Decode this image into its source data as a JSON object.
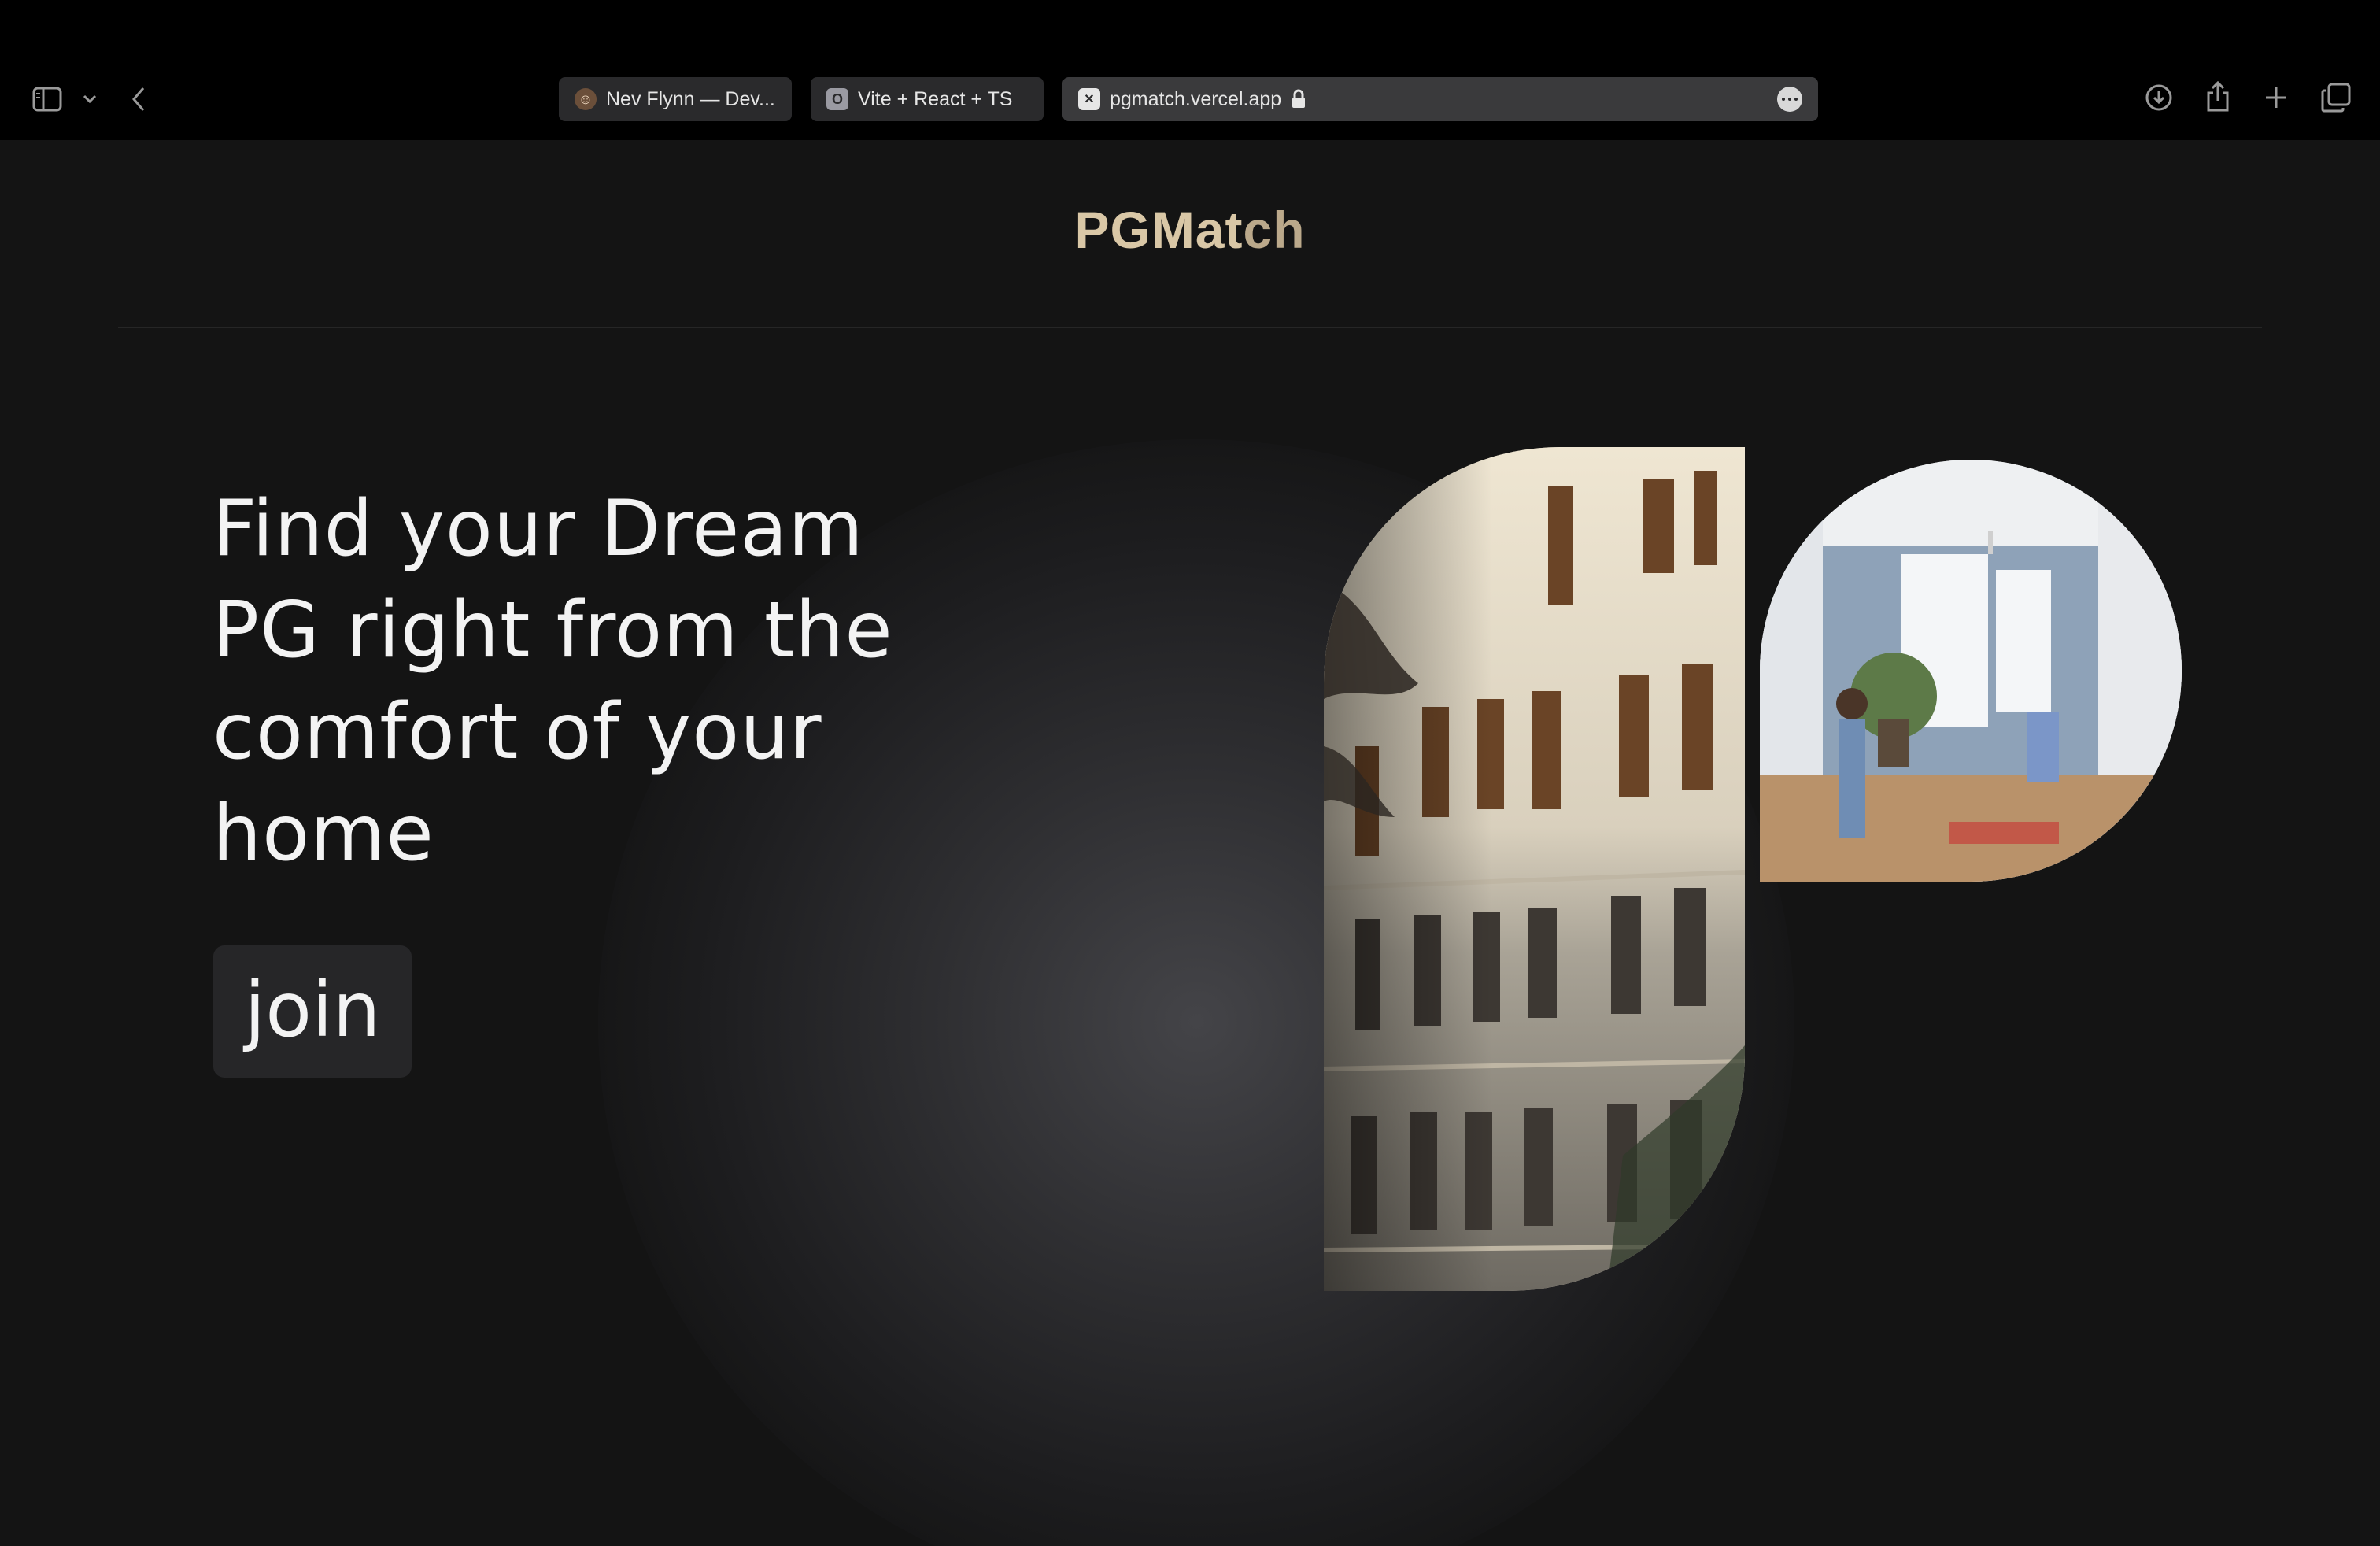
{
  "browser": {
    "tabs": [
      {
        "label": "Nev Flynn — Dev...",
        "favicon": "avatar-icon"
      },
      {
        "label": "Vite + React + TS",
        "favicon": "O"
      },
      {
        "label": "pgmatch.vercel.app",
        "favicon": "x-favicon",
        "active": true
      }
    ],
    "icons": [
      "sidebar-icon",
      "chevron-down-icon",
      "back-icon",
      "lock-icon",
      "more-icon",
      "download-icon",
      "share-icon",
      "new-tab-icon",
      "tab-overview-icon"
    ]
  },
  "header": {
    "logo_a": "PGMat",
    "logo_b": "ch"
  },
  "hero": {
    "headline_1": "Find your Dream",
    "headline_2": "PG right from the",
    "headline_3": "comfort of your",
    "headline_4": "home",
    "join_label": "join"
  },
  "colors": {
    "background": "#141414",
    "logo": "#d9c7a6",
    "text": "#f3f3f3",
    "button": "#262628"
  }
}
